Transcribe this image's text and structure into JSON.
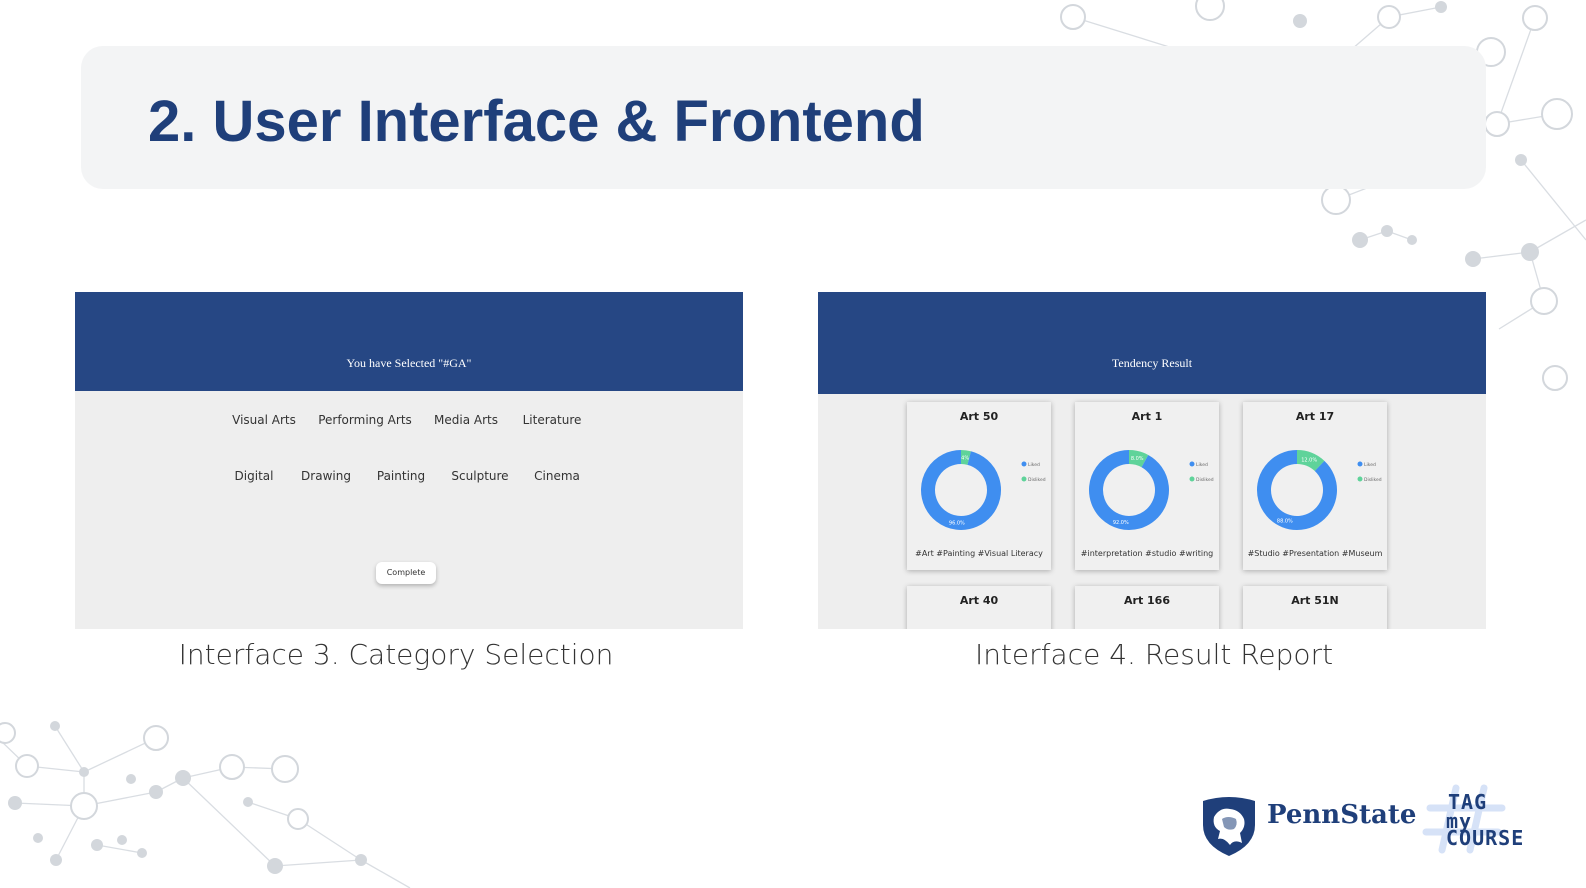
{
  "slide": {
    "title": "2. User Interface & Frontend"
  },
  "interface3": {
    "header": "You have Selected \"#GA\"",
    "row1": [
      "Visual Arts",
      "Performing Arts",
      "Media Arts",
      "Literature"
    ],
    "row2": [
      "Digital",
      "Drawing",
      "Painting",
      "Sculpture",
      "Cinema"
    ],
    "complete_label": "Complete",
    "caption": "Interface 3. Category Selection"
  },
  "interface4": {
    "header": "Tendency Result",
    "legend": [
      "Liked",
      "Disliked"
    ],
    "cards": [
      {
        "title": "Art 50",
        "tags": "#Art  #Painting  #Visual Literacy",
        "liked_pct": "96.0%",
        "disliked_pct": "4%",
        "liked": 0.96
      },
      {
        "title": "Art 1",
        "tags": "#interpretation  #studio  #writing",
        "liked_pct": "92.0%",
        "disliked_pct": "8.0%",
        "liked": 0.92
      },
      {
        "title": "Art 17",
        "tags": "#Studio  #Presentation  #Museum",
        "liked_pct": "88.0%",
        "disliked_pct": "12.0%",
        "liked": 0.88
      },
      {
        "title": "Art 40"
      },
      {
        "title": "Art 166"
      },
      {
        "title": "Art 51N"
      }
    ],
    "caption": "Interface 4. Result Report"
  },
  "logos": {
    "pennstate": "PennState",
    "tagmycourse": [
      "TAG",
      "my",
      "COURSE"
    ]
  },
  "colors": {
    "title": "#1f3f7a",
    "header_blue": "#264784",
    "liked": "#3f8ef0",
    "disliked": "#5fd39a"
  }
}
